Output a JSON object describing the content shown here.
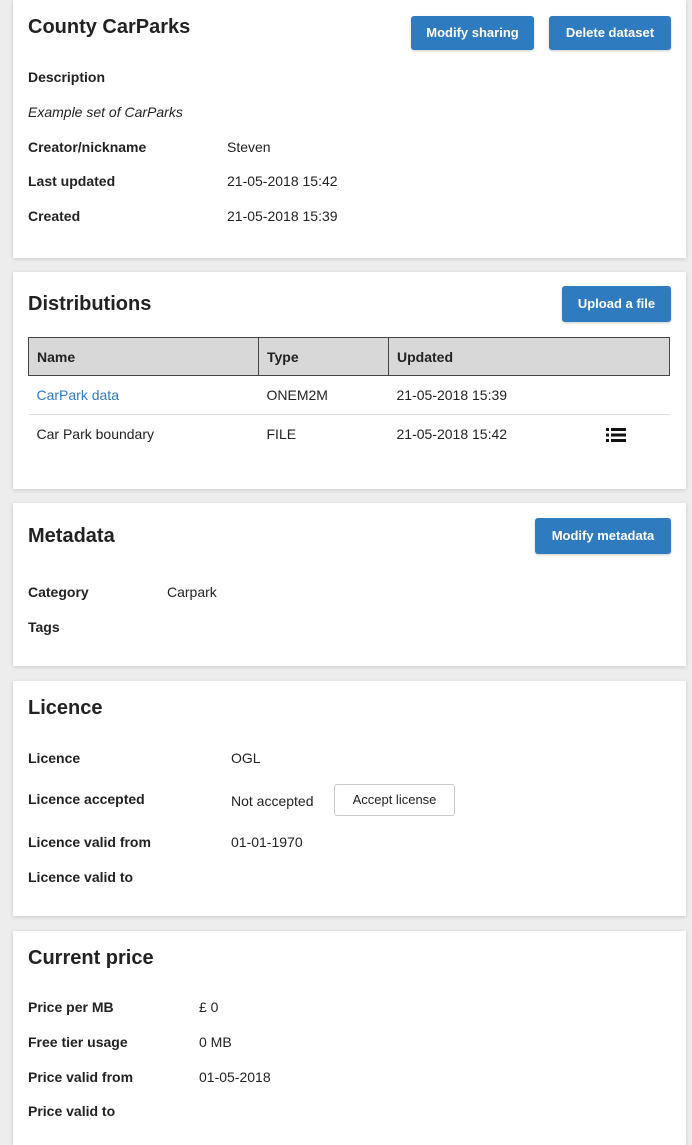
{
  "dataset": {
    "title": "County CarParks",
    "modify_sharing_label": "Modify sharing",
    "delete_label": "Delete dataset",
    "description_label": "Description",
    "description": "Example set of CarParks",
    "creator_label": "Creator/nickname",
    "creator": "Steven",
    "updated_label": "Last updated",
    "updated": "21-05-2018 15:42",
    "created_label": "Created",
    "created": "21-05-2018 15:39"
  },
  "distributions": {
    "title": "Distributions",
    "upload_label": "Upload a file",
    "columns": [
      "Name",
      "Type",
      "Updated"
    ],
    "rows": [
      {
        "name": "CarPark data",
        "type": "ONEM2M",
        "updated": "21-05-2018 15:39",
        "link": true,
        "icon": ""
      },
      {
        "name": "Car Park boundary",
        "type": "FILE",
        "updated": "21-05-2018 15:42",
        "link": false,
        "icon": "list-icon"
      }
    ]
  },
  "metadata": {
    "title": "Metadata",
    "modify_label": "Modify metadata",
    "category_label": "Category",
    "category": "Carpark",
    "tags_label": "Tags"
  },
  "licence": {
    "title": "Licence",
    "licence_label": "Licence",
    "licence": "OGL",
    "accepted_label": "Licence accepted",
    "accepted": "Not accepted",
    "accept_button": "Accept license",
    "valid_from_label": "Licence valid from",
    "valid_from": "01-01-1970",
    "valid_to_label": "Licence valid to"
  },
  "price": {
    "title": "Current price",
    "per_mb_label": "Price per MB",
    "per_mb": "£ 0",
    "free_tier_label": "Free tier usage",
    "free_tier": "0 MB",
    "valid_from_label": "Price valid from",
    "valid_from": "01-05-2018",
    "valid_to_label": "Price valid to"
  },
  "colors": {
    "primary_button": "#2f7bbf",
    "link": "#2f7bbf",
    "background": "#ededed"
  }
}
